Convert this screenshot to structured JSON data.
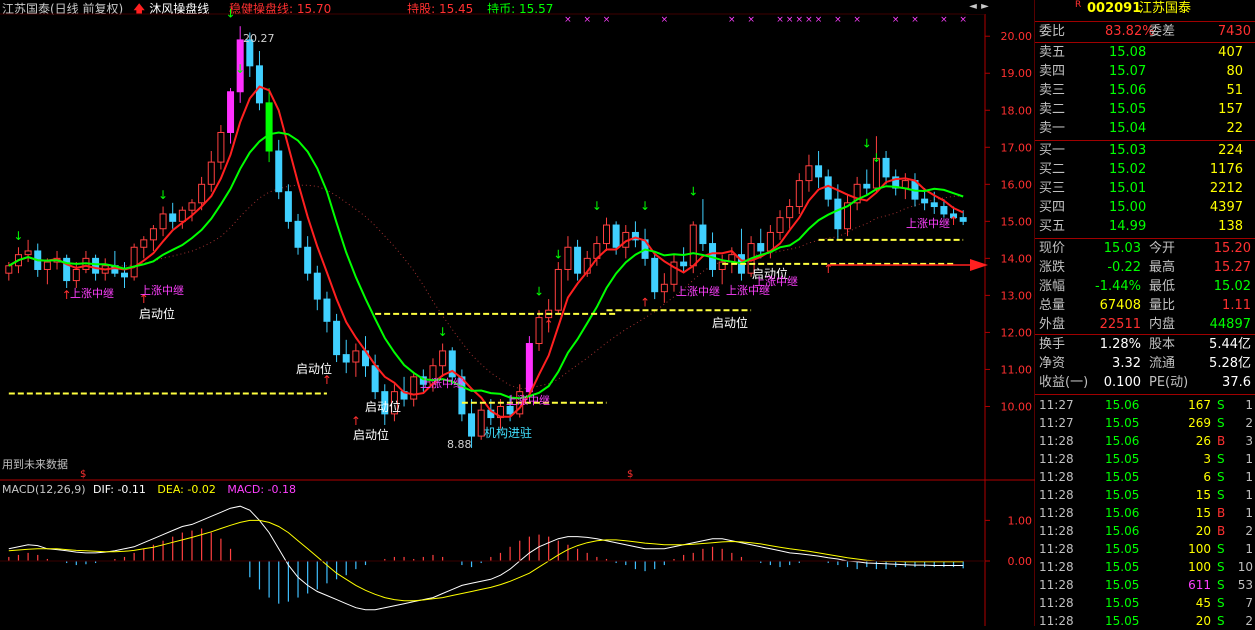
{
  "header": {
    "title": "江苏国泰(日线 前复权)",
    "indicator_name": "沐风操盘线",
    "stable_line_label": "稳健操盘线: ",
    "stable_line_value": "15.70",
    "pressure_label": "持股: ",
    "pressure_value": "15.45",
    "holding_label": "持币: ",
    "holding_value": "15.57",
    "arrow_icon": "red-up-arrow-icon",
    "colors": {
      "title": "#c8c8c8",
      "indicator": "#ffffff",
      "stable": "#ff3030",
      "pressure": "#ff3030",
      "holding": "#00ff00"
    }
  },
  "price_axis": {
    "ticks": [
      "20.00",
      "19.00",
      "18.00",
      "17.00",
      "16.00",
      "15.00",
      "14.00",
      "13.00",
      "12.00",
      "11.00",
      "10.00"
    ],
    "color": "#ff3030"
  },
  "macd_axis": {
    "ticks": [
      "1.00",
      "0.00"
    ]
  },
  "annotations": {
    "high_label": "20.27",
    "low_label": "8.88",
    "future_data_note": "用到未来数据",
    "dollar_marks": [
      "$",
      "$"
    ],
    "signal_texts": [
      {
        "text": "上涨中继",
        "color": "#ff40ff"
      },
      {
        "text": "上涨中继",
        "color": "#ff40ff"
      },
      {
        "text": "启动位",
        "color": "#ffffff"
      },
      {
        "text": "启动位",
        "color": "#ffffff"
      },
      {
        "text": "启动位",
        "color": "#ffffff"
      },
      {
        "text": "启动位",
        "color": "#ffffff"
      },
      {
        "text": "上涨中继",
        "color": "#ff40ff"
      },
      {
        "text": "上涨中继",
        "color": "#ff40ff"
      },
      {
        "text": "机构进驻",
        "color": "#40e0ff"
      },
      {
        "text": "上涨中继",
        "color": "#ff40ff"
      },
      {
        "text": "上涨中继",
        "color": "#ff40ff"
      },
      {
        "text": "启动位",
        "color": "#ffffff"
      },
      {
        "text": "启动位",
        "color": "#ffffff"
      },
      {
        "text": "上涨中继",
        "color": "#ff40ff"
      },
      {
        "text": "上涨中继",
        "color": "#ff40ff"
      }
    ]
  },
  "macd_header": {
    "name": "MACD(12,26,9)",
    "dif_label": "DIF: ",
    "dif_value": "-0.11",
    "dea_label": "DEA: ",
    "dea_value": "-0.02",
    "macd_label": "MACD: ",
    "macd_value": "-0.18",
    "colors": {
      "name": "#c8c8c8",
      "dif": "#ffffff",
      "dea": "#ffff00",
      "macd": "#ff40ff"
    }
  },
  "quote": {
    "badge": "R",
    "code": "002091",
    "name": "江苏国泰",
    "ratio": {
      "label1": "委比",
      "value1": "83.82%",
      "label2": "委差",
      "value2": "7430"
    },
    "asks": [
      {
        "label": "卖五",
        "price": "15.08",
        "vol": "407"
      },
      {
        "label": "卖四",
        "price": "15.07",
        "vol": "80"
      },
      {
        "label": "卖三",
        "price": "15.06",
        "vol": "51"
      },
      {
        "label": "卖二",
        "price": "15.05",
        "vol": "157"
      },
      {
        "label": "卖一",
        "price": "15.04",
        "vol": "22"
      }
    ],
    "bids": [
      {
        "label": "买一",
        "price": "15.03",
        "vol": "224"
      },
      {
        "label": "买二",
        "price": "15.02",
        "vol": "1176"
      },
      {
        "label": "买三",
        "price": "15.01",
        "vol": "2212"
      },
      {
        "label": "买四",
        "price": "15.00",
        "vol": "4397"
      },
      {
        "label": "买五",
        "price": "14.99",
        "vol": "138"
      }
    ],
    "stats": [
      {
        "l1": "现价",
        "v1": "15.03",
        "c1": "#00ff00",
        "l2": "今开",
        "v2": "15.20",
        "c2": "#ff3030"
      },
      {
        "l1": "涨跌",
        "v1": "-0.22",
        "c1": "#00ff00",
        "l2": "最高",
        "v2": "15.27",
        "c2": "#ff3030"
      },
      {
        "l1": "涨幅",
        "v1": "-1.44%",
        "c1": "#00ff00",
        "l2": "最低",
        "v2": "15.02",
        "c2": "#00ff00"
      },
      {
        "l1": "总量",
        "v1": "67408",
        "c1": "#ffff00",
        "l2": "量比",
        "v2": "1.11",
        "c2": "#ff3030"
      },
      {
        "l1": "外盘",
        "v1": "22511",
        "c1": "#ff3030",
        "l2": "内盘",
        "v2": "44897",
        "c2": "#00ff00"
      }
    ],
    "fundamentals": [
      {
        "l1": "换手",
        "v1": "1.28%",
        "l2": "股本",
        "v2": "5.44亿"
      },
      {
        "l1": "净资",
        "v1": "3.32",
        "l2": "流通",
        "v2": "5.28亿"
      },
      {
        "l1": "收益(一)",
        "v1": "0.100",
        "l2": "PE(动)",
        "v2": "37.6"
      }
    ],
    "ticks": [
      {
        "time": "11:27",
        "price": "15.06",
        "vol": "167",
        "side": "S",
        "n": "1"
      },
      {
        "time": "11:27",
        "price": "15.05",
        "vol": "269",
        "side": "S",
        "n": "2"
      },
      {
        "time": "11:28",
        "price": "15.06",
        "vol": "26",
        "side": "B",
        "n": "3"
      },
      {
        "time": "11:28",
        "price": "15.05",
        "vol": "3",
        "side": "S",
        "n": "1"
      },
      {
        "time": "11:28",
        "price": "15.05",
        "vol": "6",
        "side": "S",
        "n": "1"
      },
      {
        "time": "11:28",
        "price": "15.05",
        "vol": "15",
        "side": "S",
        "n": "1"
      },
      {
        "time": "11:28",
        "price": "15.06",
        "vol": "15",
        "side": "B",
        "n": "1"
      },
      {
        "time": "11:28",
        "price": "15.06",
        "vol": "20",
        "side": "B",
        "n": "2"
      },
      {
        "time": "11:28",
        "price": "15.05",
        "vol": "100",
        "side": "S",
        "n": "1"
      },
      {
        "time": "11:28",
        "price": "15.05",
        "vol": "100",
        "side": "S",
        "n": "10"
      },
      {
        "time": "11:28",
        "price": "15.05",
        "vol": "611",
        "side": "S",
        "n": "53"
      },
      {
        "time": "11:28",
        "price": "15.05",
        "vol": "45",
        "side": "S",
        "n": "7"
      },
      {
        "time": "11:28",
        "price": "15.05",
        "vol": "20",
        "side": "S",
        "n": "2"
      }
    ]
  },
  "chart_data": {
    "type": "candlestick",
    "price_range": [
      8.5,
      20.6
    ],
    "macd_range": [
      -1.6,
      1.6
    ],
    "high_marker": 20.27,
    "low_marker": 8.88,
    "candles": [
      [
        13.6,
        13.9,
        13.4,
        13.8
      ],
      [
        13.8,
        14.3,
        13.6,
        14.1
      ],
      [
        14.1,
        14.5,
        13.9,
        14.2
      ],
      [
        14.2,
        14.4,
        13.5,
        13.7
      ],
      [
        13.7,
        14.0,
        13.3,
        13.9
      ],
      [
        13.9,
        14.2,
        13.7,
        14.0
      ],
      [
        14.0,
        14.1,
        13.2,
        13.4
      ],
      [
        13.4,
        13.9,
        13.2,
        13.7
      ],
      [
        13.7,
        14.2,
        13.6,
        14.0
      ],
      [
        14.0,
        14.1,
        13.4,
        13.6
      ],
      [
        13.6,
        14.0,
        13.4,
        13.8
      ],
      [
        13.8,
        14.2,
        13.5,
        13.6
      ],
      [
        13.6,
        13.9,
        13.2,
        13.5
      ],
      [
        13.5,
        14.4,
        13.4,
        14.3
      ],
      [
        14.3,
        14.6,
        14.0,
        14.5
      ],
      [
        14.5,
        14.9,
        14.2,
        14.8
      ],
      [
        14.8,
        15.4,
        14.6,
        15.2
      ],
      [
        15.2,
        15.5,
        14.8,
        15.0
      ],
      [
        15.0,
        15.4,
        14.8,
        15.3
      ],
      [
        15.3,
        15.6,
        15.0,
        15.5
      ],
      [
        15.5,
        16.2,
        15.3,
        16.0
      ],
      [
        16.0,
        16.9,
        15.8,
        16.6
      ],
      [
        16.6,
        17.6,
        16.4,
        17.4
      ],
      [
        17.4,
        18.6,
        17.1,
        18.5
      ],
      [
        18.5,
        20.27,
        18.2,
        19.9
      ],
      [
        19.9,
        20.1,
        18.9,
        19.2
      ],
      [
        19.2,
        19.6,
        18.0,
        18.2
      ],
      [
        18.2,
        18.6,
        16.6,
        16.9
      ],
      [
        16.9,
        17.2,
        15.6,
        15.8
      ],
      [
        15.8,
        16.0,
        14.8,
        15.0
      ],
      [
        15.0,
        15.2,
        14.1,
        14.3
      ],
      [
        14.3,
        14.6,
        13.4,
        13.6
      ],
      [
        13.6,
        13.8,
        12.6,
        12.9
      ],
      [
        12.9,
        13.1,
        12.0,
        12.3
      ],
      [
        12.3,
        12.5,
        11.2,
        11.4
      ],
      [
        11.4,
        11.8,
        10.9,
        11.2
      ],
      [
        11.2,
        11.7,
        10.8,
        11.5
      ],
      [
        11.5,
        11.9,
        10.8,
        11.1
      ],
      [
        11.1,
        11.4,
        10.2,
        10.4
      ],
      [
        10.4,
        10.6,
        9.5,
        9.8
      ],
      [
        9.8,
        10.6,
        9.6,
        10.4
      ],
      [
        10.4,
        10.8,
        10.0,
        10.2
      ],
      [
        10.2,
        10.9,
        10.0,
        10.8
      ],
      [
        10.8,
        11.0,
        10.4,
        10.6
      ],
      [
        10.6,
        11.3,
        10.4,
        11.1
      ],
      [
        11.1,
        11.7,
        10.8,
        11.5
      ],
      [
        11.5,
        11.6,
        10.6,
        10.8
      ],
      [
        10.8,
        11.0,
        9.6,
        9.8
      ],
      [
        9.8,
        10.2,
        8.88,
        9.2
      ],
      [
        9.2,
        10.1,
        9.1,
        9.9
      ],
      [
        9.9,
        10.2,
        9.5,
        9.7
      ],
      [
        9.7,
        10.2,
        9.4,
        10.0
      ],
      [
        10.0,
        10.3,
        9.6,
        9.8
      ],
      [
        9.8,
        10.6,
        9.7,
        10.4
      ],
      [
        10.4,
        11.9,
        10.3,
        11.7
      ],
      [
        11.7,
        12.6,
        11.5,
        12.4
      ],
      [
        12.4,
        12.9,
        12.0,
        12.6
      ],
      [
        12.6,
        13.9,
        12.5,
        13.7
      ],
      [
        13.7,
        14.6,
        13.4,
        14.3
      ],
      [
        14.3,
        14.5,
        13.4,
        13.6
      ],
      [
        13.6,
        14.2,
        13.5,
        14.0
      ],
      [
        14.0,
        14.6,
        13.8,
        14.4
      ],
      [
        14.4,
        15.1,
        14.2,
        14.9
      ],
      [
        14.9,
        15.0,
        14.1,
        14.3
      ],
      [
        14.3,
        14.9,
        14.0,
        14.7
      ],
      [
        14.7,
        15.0,
        14.3,
        14.5
      ],
      [
        14.5,
        14.8,
        13.8,
        14.0
      ],
      [
        14.0,
        14.2,
        12.9,
        13.1
      ],
      [
        13.1,
        13.6,
        12.8,
        13.3
      ],
      [
        13.3,
        14.1,
        13.1,
        13.9
      ],
      [
        13.9,
        14.3,
        13.6,
        13.8
      ],
      [
        13.8,
        15.0,
        13.6,
        14.9
      ],
      [
        14.9,
        15.6,
        14.2,
        14.4
      ],
      [
        14.4,
        14.7,
        13.5,
        13.7
      ],
      [
        13.7,
        14.1,
        13.3,
        13.9
      ],
      [
        13.9,
        14.3,
        13.6,
        14.1
      ],
      [
        14.1,
        14.8,
        13.4,
        13.6
      ],
      [
        13.6,
        14.6,
        13.5,
        14.4
      ],
      [
        14.4,
        14.8,
        14.0,
        14.2
      ],
      [
        14.2,
        14.9,
        14.0,
        14.7
      ],
      [
        14.7,
        15.3,
        14.5,
        15.1
      ],
      [
        15.1,
        15.6,
        14.8,
        15.4
      ],
      [
        15.4,
        16.3,
        15.2,
        16.1
      ],
      [
        16.1,
        16.8,
        15.8,
        16.5
      ],
      [
        16.5,
        16.9,
        15.9,
        16.2
      ],
      [
        16.2,
        16.4,
        15.4,
        15.6
      ],
      [
        15.6,
        16.0,
        14.5,
        14.8
      ],
      [
        14.8,
        15.7,
        14.6,
        15.5
      ],
      [
        15.5,
        16.2,
        15.3,
        16.0
      ],
      [
        16.0,
        16.4,
        15.7,
        15.9
      ],
      [
        15.9,
        17.3,
        15.8,
        16.7
      ],
      [
        16.7,
        16.9,
        16.0,
        16.2
      ],
      [
        16.2,
        16.4,
        15.7,
        15.9
      ],
      [
        15.9,
        16.3,
        15.6,
        16.1
      ],
      [
        16.1,
        16.3,
        15.4,
        15.6
      ],
      [
        15.6,
        15.9,
        15.3,
        15.5
      ],
      [
        15.5,
        15.8,
        15.2,
        15.4
      ],
      [
        15.4,
        15.6,
        15.1,
        15.2
      ],
      [
        15.2,
        15.4,
        15.0,
        15.1
      ],
      [
        15.1,
        15.3,
        14.9,
        15.0
      ]
    ],
    "macd_histogram": [
      0.1,
      0.15,
      0.2,
      0.15,
      0.05,
      0.0,
      -0.05,
      -0.1,
      -0.08,
      -0.05,
      0.0,
      0.05,
      0.1,
      0.2,
      0.3,
      0.4,
      0.5,
      0.6,
      0.7,
      0.75,
      0.8,
      0.7,
      0.55,
      0.3,
      0.0,
      -0.4,
      -0.7,
      -0.9,
      -1.05,
      -1.0,
      -0.9,
      -0.8,
      -0.7,
      -0.55,
      -0.45,
      -0.35,
      -0.2,
      -0.1,
      0.0,
      0.05,
      0.1,
      0.1,
      0.05,
      0.1,
      0.15,
      0.1,
      0.0,
      -0.1,
      -0.15,
      -0.05,
      0.1,
      0.2,
      0.35,
      0.5,
      0.6,
      0.65,
      0.6,
      0.5,
      0.4,
      0.3,
      0.2,
      0.1,
      0.05,
      -0.05,
      -0.1,
      -0.2,
      -0.25,
      -0.2,
      -0.1,
      0.05,
      0.15,
      0.2,
      0.3,
      0.35,
      0.3,
      0.2,
      0.1,
      0.0,
      -0.05,
      -0.1,
      -0.15,
      -0.1,
      -0.05,
      0.0,
      0.0,
      -0.05,
      -0.1,
      -0.15,
      -0.2,
      -0.15,
      -0.2,
      -0.2,
      -0.15,
      -0.15,
      -0.15,
      -0.15,
      -0.15,
      -0.15,
      -0.15,
      -0.18
    ],
    "dif": [
      0.3,
      0.35,
      0.4,
      0.38,
      0.3,
      0.28,
      0.25,
      0.22,
      0.2,
      0.2,
      0.22,
      0.25,
      0.3,
      0.35,
      0.45,
      0.55,
      0.65,
      0.75,
      0.85,
      0.9,
      1.0,
      1.1,
      1.2,
      1.3,
      1.35,
      1.25,
      1.0,
      0.7,
      0.3,
      -0.1,
      -0.4,
      -0.6,
      -0.75,
      -0.85,
      -0.95,
      -1.05,
      -1.15,
      -1.2,
      -1.2,
      -1.15,
      -1.1,
      -1.05,
      -1.0,
      -0.95,
      -0.9,
      -0.8,
      -0.7,
      -0.6,
      -0.55,
      -0.5,
      -0.45,
      -0.35,
      -0.2,
      0.0,
      0.2,
      0.35,
      0.45,
      0.55,
      0.6,
      0.6,
      0.58,
      0.55,
      0.5,
      0.45,
      0.4,
      0.35,
      0.3,
      0.3,
      0.3,
      0.35,
      0.4,
      0.45,
      0.5,
      0.55,
      0.55,
      0.5,
      0.45,
      0.4,
      0.35,
      0.3,
      0.25,
      0.2,
      0.18,
      0.15,
      0.12,
      0.08,
      0.05,
      0.0,
      -0.02,
      -0.05,
      -0.06,
      -0.07,
      -0.08,
      -0.09,
      -0.1,
      -0.1,
      -0.11,
      -0.11,
      -0.11,
      -0.11
    ],
    "dea": [
      0.25,
      0.27,
      0.29,
      0.3,
      0.3,
      0.3,
      0.28,
      0.26,
      0.25,
      0.24,
      0.23,
      0.23,
      0.24,
      0.26,
      0.3,
      0.34,
      0.4,
      0.46,
      0.52,
      0.58,
      0.65,
      0.72,
      0.8,
      0.88,
      0.95,
      1.0,
      1.0,
      0.95,
      0.85,
      0.7,
      0.5,
      0.3,
      0.1,
      -0.1,
      -0.3,
      -0.45,
      -0.6,
      -0.72,
      -0.82,
      -0.9,
      -0.95,
      -0.98,
      -0.98,
      -0.96,
      -0.93,
      -0.9,
      -0.85,
      -0.8,
      -0.75,
      -0.7,
      -0.65,
      -0.58,
      -0.5,
      -0.4,
      -0.3,
      -0.15,
      0.0,
      0.15,
      0.28,
      0.38,
      0.45,
      0.5,
      0.52,
      0.52,
      0.5,
      0.47,
      0.44,
      0.42,
      0.4,
      0.4,
      0.4,
      0.41,
      0.43,
      0.45,
      0.47,
      0.48,
      0.47,
      0.45,
      0.42,
      0.38,
      0.34,
      0.3,
      0.27,
      0.24,
      0.2,
      0.16,
      0.12,
      0.08,
      0.05,
      0.02,
      0.0,
      -0.01,
      -0.01,
      -0.02,
      -0.02,
      -0.02,
      -0.02,
      -0.02,
      -0.02,
      -0.02
    ]
  }
}
